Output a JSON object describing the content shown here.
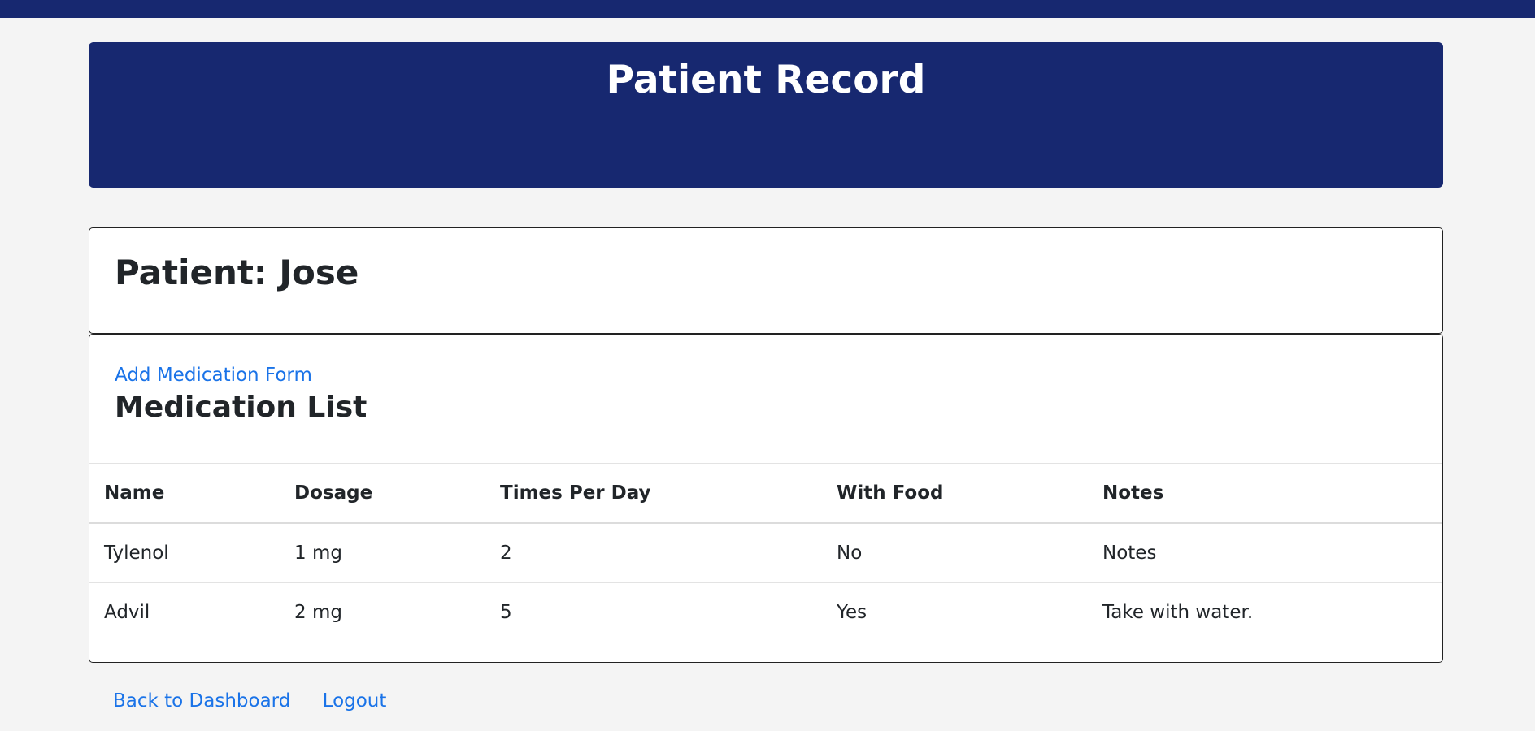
{
  "header": {
    "title": "Patient Record"
  },
  "patient": {
    "heading": "Patient: Jose"
  },
  "medications": {
    "add_link": "Add Medication Form",
    "heading": "Medication List",
    "columns": [
      "Name",
      "Dosage",
      "Times Per Day",
      "With Food",
      "Notes"
    ],
    "rows": [
      [
        "Tylenol",
        "1 mg",
        "2",
        "No",
        "Notes"
      ],
      [
        "Advil",
        "2 mg",
        "5",
        "Yes",
        "Take with water."
      ]
    ]
  },
  "footer": {
    "back_link": "Back to Dashboard",
    "logout_link": "Logout"
  },
  "colors": {
    "brand": "#172870",
    "link": "#1a73e8",
    "background": "#f4f4f4"
  }
}
